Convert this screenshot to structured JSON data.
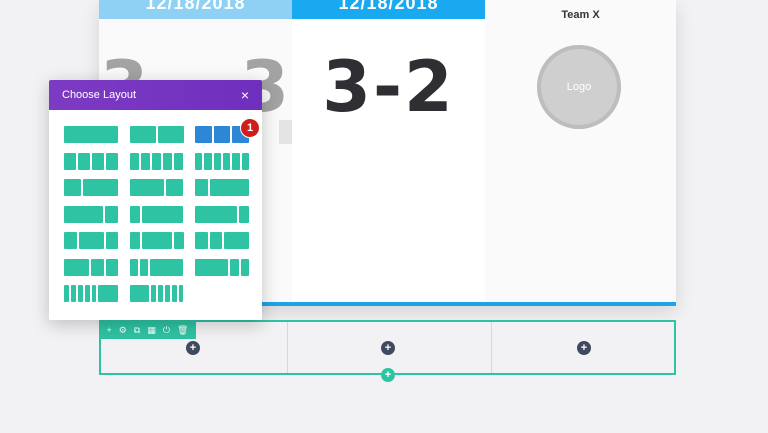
{
  "card": {
    "col1": {
      "date": "12/18/2018",
      "score": "3 – 3"
    },
    "col2": {
      "date": "12/18/2018",
      "score": "3-2"
    },
    "col3": {
      "team": "Team X",
      "logo": "Logo"
    }
  },
  "modal": {
    "title": "Choose Layout",
    "close": "×",
    "badge": "1",
    "layouts": [
      [
        [
          1
        ],
        [
          1,
          1
        ],
        [
          1,
          1,
          1
        ]
      ],
      [
        [
          1,
          1,
          1,
          1
        ],
        [
          1,
          1,
          1,
          1,
          1
        ],
        [
          1,
          1,
          1,
          1,
          1,
          1
        ]
      ],
      [
        [
          1,
          2
        ],
        [
          2,
          1
        ],
        [
          1,
          3
        ]
      ],
      [
        [
          3,
          1
        ],
        [
          1,
          4
        ],
        [
          4,
          1
        ]
      ],
      [
        [
          1,
          2,
          1
        ],
        [
          1,
          3,
          1
        ],
        [
          1,
          1,
          2
        ]
      ],
      [
        [
          2,
          1,
          1
        ],
        [
          1,
          1,
          4
        ],
        [
          4,
          1,
          1
        ]
      ],
      [
        [
          1,
          1,
          1,
          1,
          1,
          4
        ],
        [
          4,
          1,
          1,
          1,
          1,
          1
        ],
        []
      ]
    ],
    "selected": [
      0,
      2
    ]
  },
  "toolbar": {
    "icons": [
      "+",
      "⚙",
      "⧉",
      "▦",
      "⏻",
      "🗑"
    ]
  },
  "row_builder": {
    "add_module": "+",
    "add_row": "+"
  },
  "colors": {
    "accent": "#2ec3a2",
    "selected": "#2d86d6",
    "header": "#7d3bc4",
    "blue_bar": "#1ea3e6",
    "badge": "#d11c1c"
  }
}
